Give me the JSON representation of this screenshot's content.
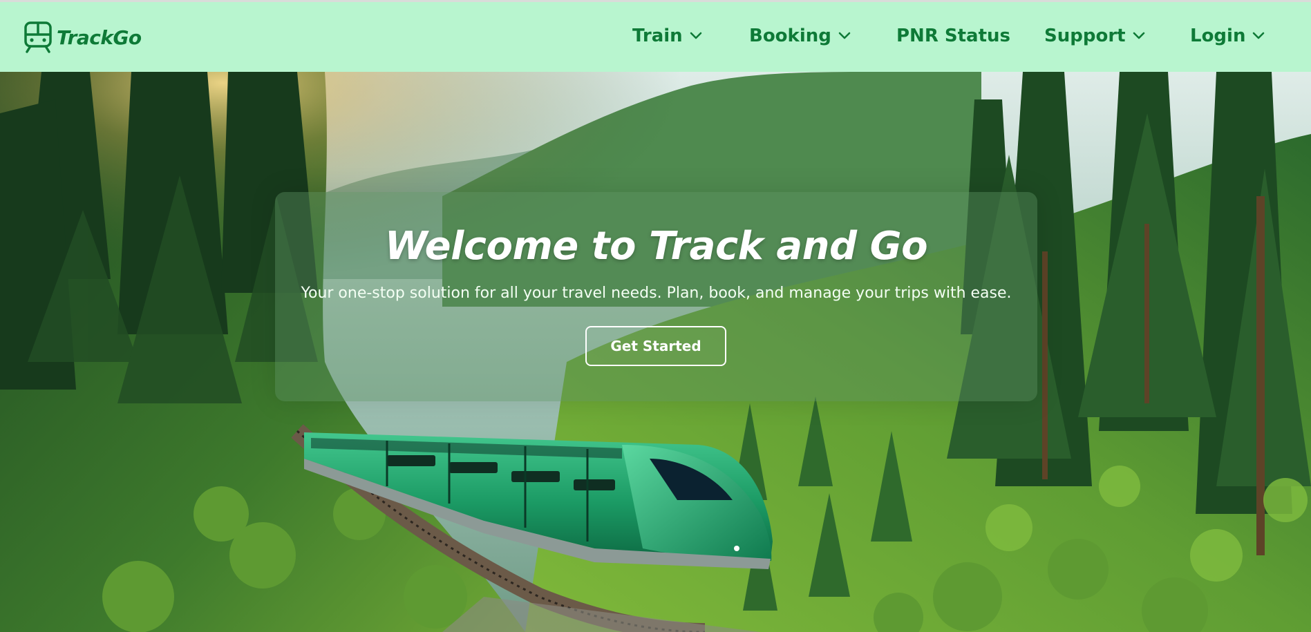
{
  "brand": {
    "name": "TrackGo",
    "icon": "train-icon"
  },
  "nav": {
    "items": [
      {
        "label": "Train",
        "has_dropdown": true
      },
      {
        "label": "Booking",
        "has_dropdown": true
      },
      {
        "label": "PNR Status",
        "has_dropdown": false
      },
      {
        "label": "Support",
        "has_dropdown": true
      },
      {
        "label": "Login",
        "has_dropdown": true
      }
    ]
  },
  "hero": {
    "title": "Welcome to Track and Go",
    "subtitle": "Your one-stop solution for all your travel needs. Plan, book, and manage your trips with ease.",
    "cta_label": "Get Started"
  },
  "colors": {
    "navbar_bg": "#b8f5cf",
    "brand_green": "#0e7a37",
    "card_overlay": "rgba(90,140,95,0.42)",
    "train_green": "#1fa36b"
  }
}
